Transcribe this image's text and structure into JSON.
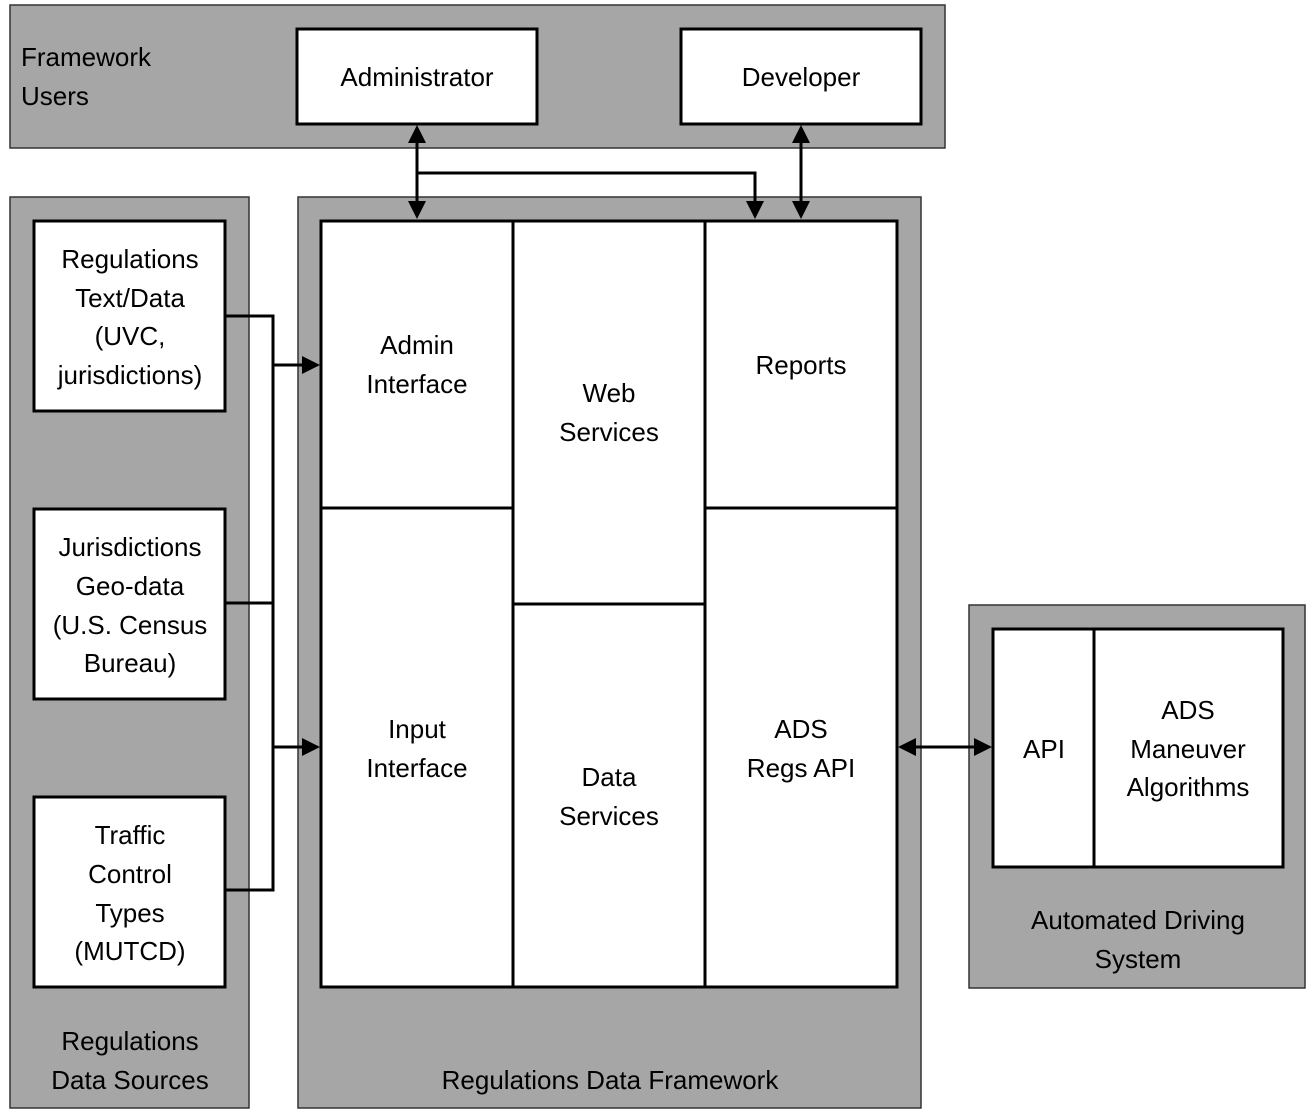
{
  "groups": {
    "framework_users": {
      "label": [
        "Framework",
        "Users"
      ]
    },
    "data_sources": {
      "label": [
        "Regulations",
        "Data Sources"
      ]
    },
    "framework": {
      "label": "Regulations Data Framework"
    },
    "ads": {
      "label": [
        "Automated Driving",
        "System"
      ]
    }
  },
  "users": {
    "administrator": "Administrator",
    "developer": "Developer"
  },
  "sources": [
    {
      "lines": [
        "Regulations",
        "Text/Data",
        "(UVC,",
        "jurisdictions)"
      ]
    },
    {
      "lines": [
        "Jurisdictions",
        "Geo-data",
        "(U.S. Census",
        "Bureau)"
      ]
    },
    {
      "lines": [
        "Traffic",
        "Control",
        "Types",
        "(MUTCD)"
      ]
    }
  ],
  "framework_modules": {
    "admin_interface": [
      "Admin",
      "Interface"
    ],
    "input_interface": [
      "Input",
      "Interface"
    ],
    "web_services": [
      "Web",
      "Services"
    ],
    "data_services": [
      "Data",
      "Services"
    ],
    "reports": [
      "Reports"
    ],
    "ads_regs_api": [
      "ADS",
      "Regs API"
    ]
  },
  "ads_modules": {
    "api": "API",
    "maneuver": [
      "ADS",
      "Maneuver",
      "Algorithms"
    ]
  }
}
